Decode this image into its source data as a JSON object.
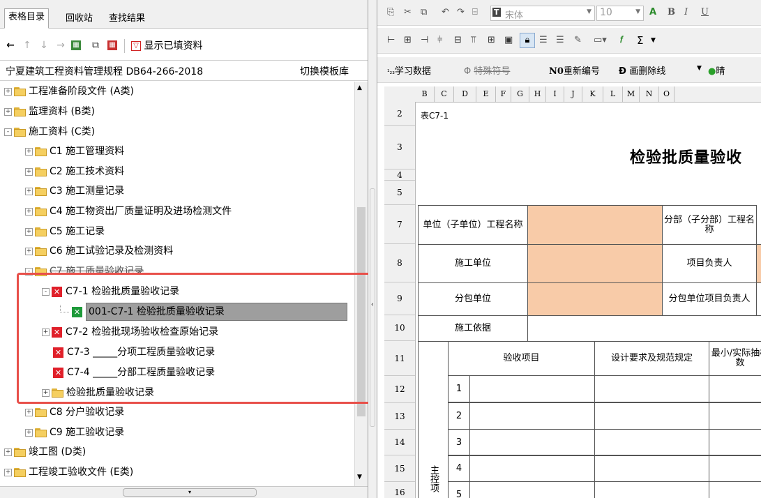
{
  "left_panel": {
    "tabs": [
      "表格目录",
      "回收站",
      "查找结果"
    ],
    "toolbar": {
      "show_filled_label": "显示已填资料"
    },
    "path": {
      "text": "宁夏建筑工程资料管理规程 DB64-266-2018",
      "switch_button": "切换模板库"
    },
    "tree": [
      {
        "label": "工程准备阶段文件 (A类)",
        "expander": "+"
      },
      {
        "label": "监理资料 (B类)",
        "expander": "+"
      },
      {
        "label": "施工资料 (C类)",
        "expander": "-"
      },
      {
        "label": "C1 施工管理资料",
        "expander": "+"
      },
      {
        "label": "C2 施工技术资料",
        "expander": "+"
      },
      {
        "label": "C3 施工测量记录",
        "expander": "+"
      },
      {
        "label": "C4 施工物资出厂质量证明及进场检测文件",
        "expander": "+"
      },
      {
        "label": "C5 施工记录",
        "expander": "+"
      },
      {
        "label": "C6 施工试验记录及检测资料",
        "expander": "+"
      },
      {
        "label": "C7 施工质量验收记录",
        "expander": "-"
      },
      {
        "label": "C7-1 检验批质量验收记录",
        "expander": "-"
      },
      {
        "label": "001-C7-1 检验批质量验收记录",
        "expander": ""
      },
      {
        "label": "C7-2 检验批现场验收检查原始记录",
        "expander": "+"
      },
      {
        "label": "C7-3 _____分项工程质量验收记录",
        "expander": ""
      },
      {
        "label": "C7-4 _____分部工程质量验收记录",
        "expander": ""
      },
      {
        "label": "检验批质量验收记录",
        "expander": "+"
      },
      {
        "label": "C8 分户验收记录",
        "expander": "+"
      },
      {
        "label": "C9 施工验收记录",
        "expander": "+"
      },
      {
        "label": "竣工图 (D类)",
        "expander": "+"
      },
      {
        "label": "工程竣工验收文件 (E类)",
        "expander": "+"
      }
    ]
  },
  "right_panel": {
    "toolbar1": {
      "font_name": "宋体",
      "font_size": "10"
    },
    "toolbar2": {
      "sigma": "Σ"
    },
    "toolbar3": {
      "learn": "学习数据",
      "special": "特殊符号",
      "renumber": "重新编号",
      "delete_line": "画删除线",
      "extra": "晴"
    },
    "columns": [
      "B",
      "C",
      "D",
      "E",
      "F",
      "G",
      "H",
      "I",
      "J",
      "K",
      "L",
      "M",
      "N",
      "O"
    ],
    "rows": [
      "2",
      "3",
      "4",
      "5",
      "7",
      "8",
      "9",
      "10",
      "11",
      "12",
      "13",
      "14",
      "15",
      "16"
    ],
    "sheet": {
      "table_id": "表C7-1",
      "title": "检验批质量验收",
      "unit_label": "单位（子单位）工程名称",
      "sub_label": "分部（子分部）工程名称",
      "construction_unit": "施工单位",
      "project_leader": "项目负责人",
      "subcontract_unit": "分包单位",
      "subcontract_leader": "分包单位项目负责人",
      "basis": "施工依据",
      "check_item": "验收项目",
      "design_req": "设计要求及规范规定",
      "min_sample": "最小/实际抽样数",
      "main_control": "主控项",
      "items": [
        "1",
        "2",
        "3",
        "4",
        "5"
      ]
    }
  }
}
